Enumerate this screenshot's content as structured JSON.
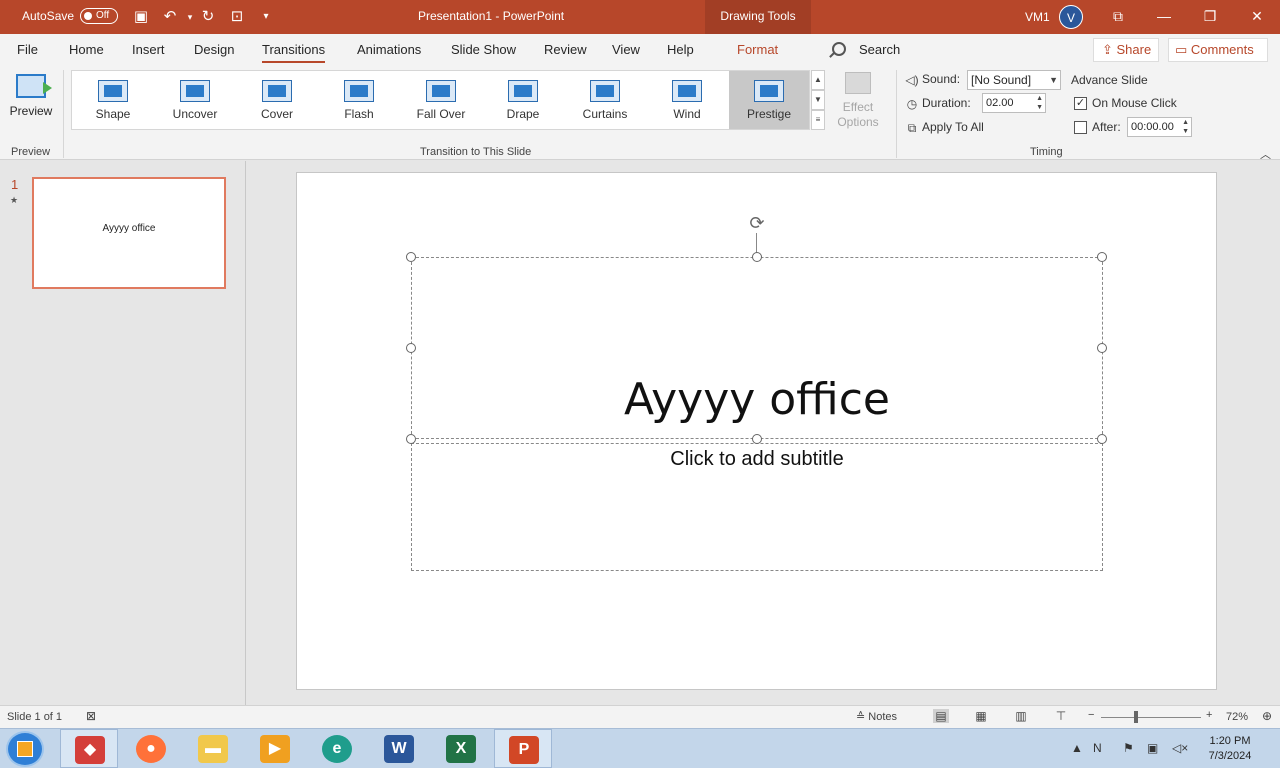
{
  "titlebar": {
    "autosave_label": "AutoSave",
    "autosave_state": "Off",
    "doc_title": "Presentation1  -  PowerPoint",
    "context_tab": "Drawing Tools",
    "user_name": "VM1",
    "avatar_initial": "V",
    "brand_color": "#b7472a"
  },
  "menu": {
    "tabs": [
      "File",
      "Home",
      "Insert",
      "Design",
      "Transitions",
      "Animations",
      "Slide Show",
      "Review",
      "View",
      "Help",
      "Format"
    ],
    "active_tab": "Transitions",
    "search_label": "Search",
    "share_label": "Share",
    "comments_label": "Comments"
  },
  "ribbon": {
    "preview_label": "Preview",
    "preview_group": "Preview",
    "transition_group": "Transition to This Slide",
    "transitions": [
      "Shape",
      "Uncover",
      "Cover",
      "Flash",
      "Fall Over",
      "Drape",
      "Curtains",
      "Wind",
      "Prestige"
    ],
    "selected_transition": "Prestige",
    "effect_options_line1": "Effect",
    "effect_options_line2": "Options",
    "sound_label": "Sound:",
    "sound_value": "[No Sound]",
    "duration_label": "Duration:",
    "duration_value": "02.00",
    "apply_all_label": "Apply To All",
    "advance_label": "Advance Slide",
    "on_mouse_click_label": "On Mouse Click",
    "on_mouse_click_checked": true,
    "after_label": "After:",
    "after_value": "00:00.00",
    "after_checked": false,
    "timing_group": "Timing"
  },
  "slides_panel": {
    "slide_number": "1",
    "thumb_text": "Ayyyy office"
  },
  "slide": {
    "title": "Ayyyy office",
    "subtitle_placeholder": "Click to add subtitle"
  },
  "status": {
    "slide_info": "Slide 1 of 1",
    "notes_label": "Notes",
    "zoom": "72%"
  },
  "taskbar": {
    "time": "1:20 PM",
    "date": "7/3/2024",
    "apps": [
      "gamemaker",
      "firefox",
      "file-explorer",
      "media-player",
      "edge",
      "word",
      "excel",
      "powerpoint"
    ]
  }
}
